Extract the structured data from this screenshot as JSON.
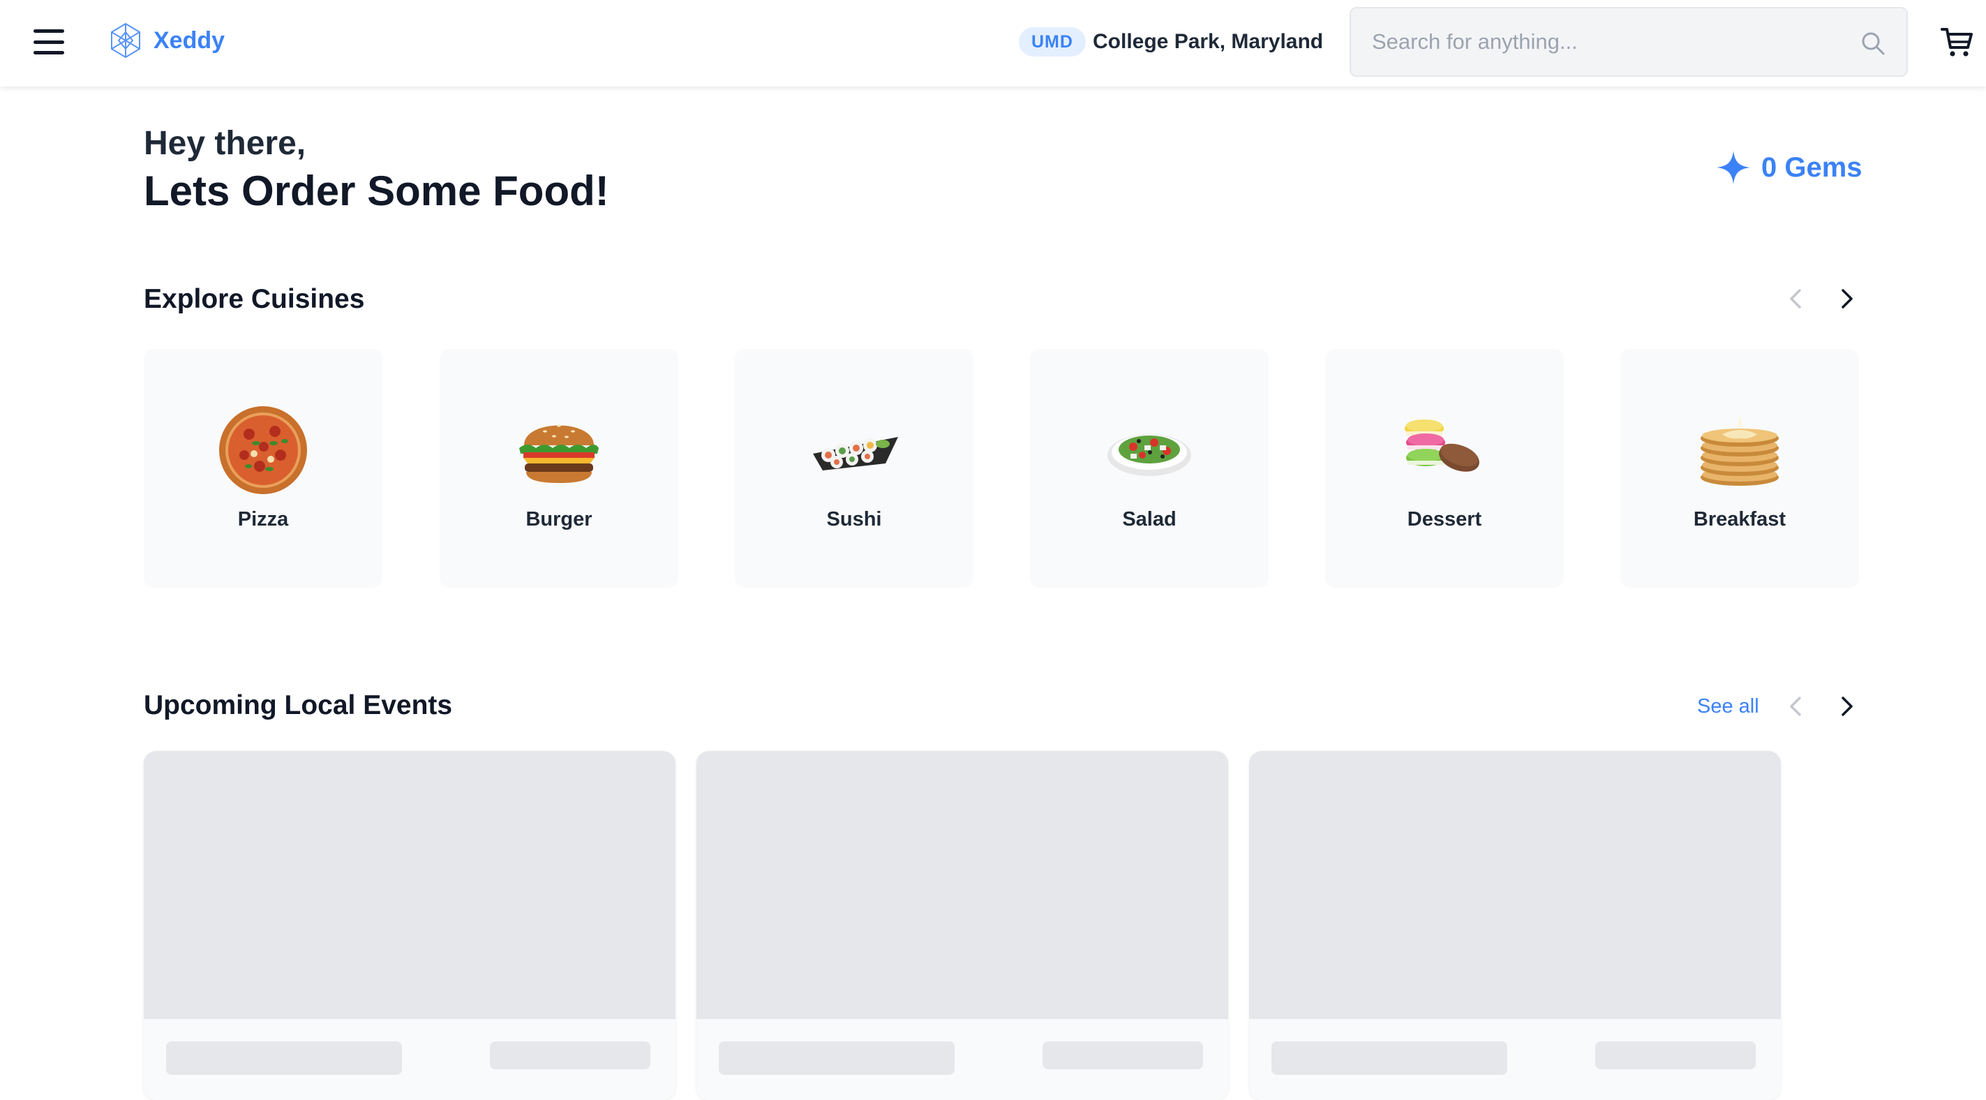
{
  "header": {
    "brand": "Xeddy",
    "campus_badge": "UMD",
    "location": "College Park, Maryland",
    "search_placeholder": "Search for anything...",
    "icons": [
      "menu-icon",
      "logo-icon",
      "search-icon",
      "cart-icon"
    ]
  },
  "greeting": {
    "line1": "Hey there,",
    "line2": "Lets Order Some Food!"
  },
  "gems": {
    "label": "0 Gems",
    "icon": "sparkle-icon"
  },
  "cuisines": {
    "title": "Explore Cuisines",
    "items": [
      {
        "label": "Pizza"
      },
      {
        "label": "Burger"
      },
      {
        "label": "Sushi"
      },
      {
        "label": "Salad"
      },
      {
        "label": "Dessert"
      },
      {
        "label": "Breakfast"
      }
    ]
  },
  "events": {
    "title": "Upcoming Local Events",
    "see_all": "See all"
  },
  "colors": {
    "accent": "#3b82f6",
    "badge_bg": "#e3efff",
    "card_bg": "#f9fafb",
    "skeleton": "#e5e7eb"
  }
}
